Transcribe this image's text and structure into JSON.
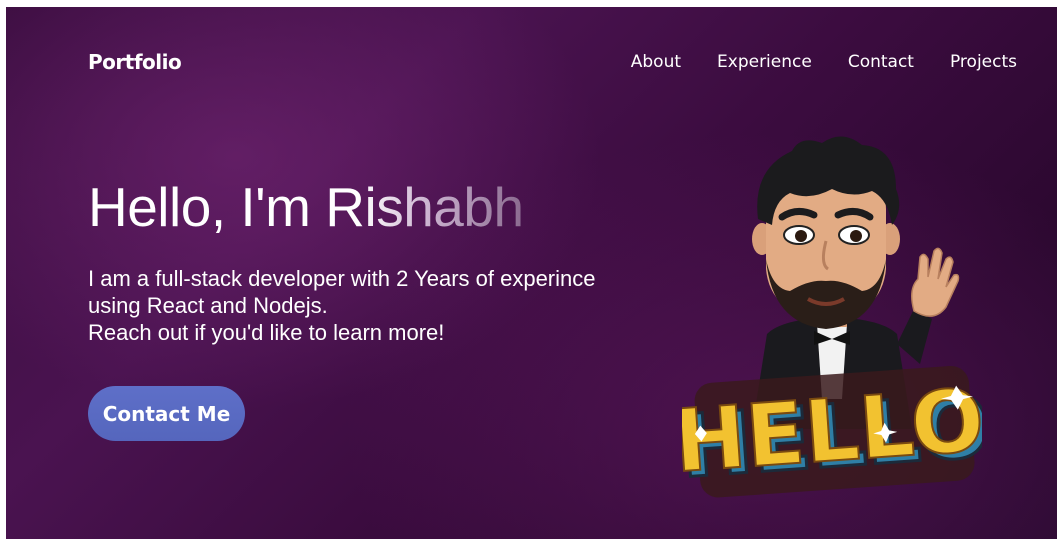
{
  "navbar": {
    "brand": "Portfolio",
    "links": [
      "About",
      "Experience",
      "Contact",
      "Projects"
    ]
  },
  "hero": {
    "title": "Hello, I'm Rishabh",
    "description_lines": [
      "I am a full-stack developer with 2 Years of experince",
      "using React and Nodejs.",
      "Reach out if you'd like to learn more!"
    ],
    "cta_label": "Contact Me",
    "sign_text": "HELLO"
  },
  "colors": {
    "background": "#3a0d3f",
    "button": "#5a6bc4",
    "text": "#ffffff",
    "sign_fill": "#f2c230",
    "sign_shadow": "#2f7fa6"
  },
  "icons": {
    "avatar": "bitmoji-avatar-hello-sticker"
  }
}
